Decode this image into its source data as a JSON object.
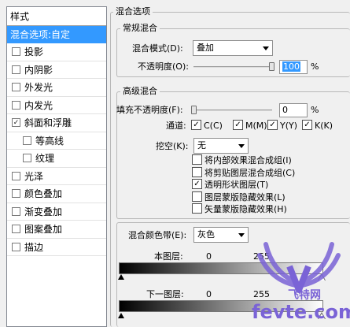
{
  "styles_panel": {
    "header": "样式",
    "blend_options": "混合选项:自定",
    "items": [
      {
        "label": "投影",
        "checked": false,
        "sub": false
      },
      {
        "label": "内阴影",
        "checked": false,
        "sub": false
      },
      {
        "label": "外发光",
        "checked": false,
        "sub": false
      },
      {
        "label": "内发光",
        "checked": false,
        "sub": false
      },
      {
        "label": "斜面和浮雕",
        "checked": true,
        "sub": false
      },
      {
        "label": "等高线",
        "checked": false,
        "sub": true
      },
      {
        "label": "纹理",
        "checked": false,
        "sub": true
      },
      {
        "label": "光泽",
        "checked": false,
        "sub": false
      },
      {
        "label": "颜色叠加",
        "checked": false,
        "sub": false
      },
      {
        "label": "渐变叠加",
        "checked": false,
        "sub": false
      },
      {
        "label": "图案叠加",
        "checked": false,
        "sub": false
      },
      {
        "label": "描边",
        "checked": false,
        "sub": false
      }
    ]
  },
  "blending": {
    "title": "混合选项",
    "general": {
      "title": "常规混合",
      "mode_label": "混合模式(D):",
      "mode_value": "叠加",
      "opacity_label": "不透明度(O):",
      "opacity_value": "100",
      "opacity_unit": "%",
      "opacity_level": 1.0
    },
    "advanced": {
      "title": "高级混合",
      "fill_label": "填充不透明度(F):",
      "fill_value": "0",
      "fill_unit": "%",
      "fill_level": 0.0,
      "channels_label": "通道:",
      "channels": [
        {
          "label": "C(C)",
          "checked": true
        },
        {
          "label": "M(M)",
          "checked": true
        },
        {
          "label": "Y(Y)",
          "checked": true
        },
        {
          "label": "K(K)",
          "checked": true
        }
      ],
      "knockout_label": "挖空(K):",
      "knockout_value": "无",
      "options": [
        {
          "label": "将内部效果混合成组(I)",
          "checked": false
        },
        {
          "label": "将剪贴图层混合成组(C)",
          "checked": false
        },
        {
          "label": "透明形状图层(T)",
          "checked": true
        },
        {
          "label": "图层蒙版隐藏效果(L)",
          "checked": false
        },
        {
          "label": "矢量蒙版隐藏效果(H)",
          "checked": false
        }
      ]
    },
    "blend_if": {
      "label": "混合颜色带(E):",
      "value": "灰色",
      "this_layer": {
        "label": "本图层:",
        "min": "0",
        "max": "255"
      },
      "underlying": {
        "label": "下一图层:",
        "min": "0",
        "max": "255"
      }
    }
  },
  "watermark": {
    "brand": "飞特网",
    "url": "fevte.com"
  },
  "colors": {
    "selection": "#3399ff",
    "watermark": "#7a63d6"
  }
}
